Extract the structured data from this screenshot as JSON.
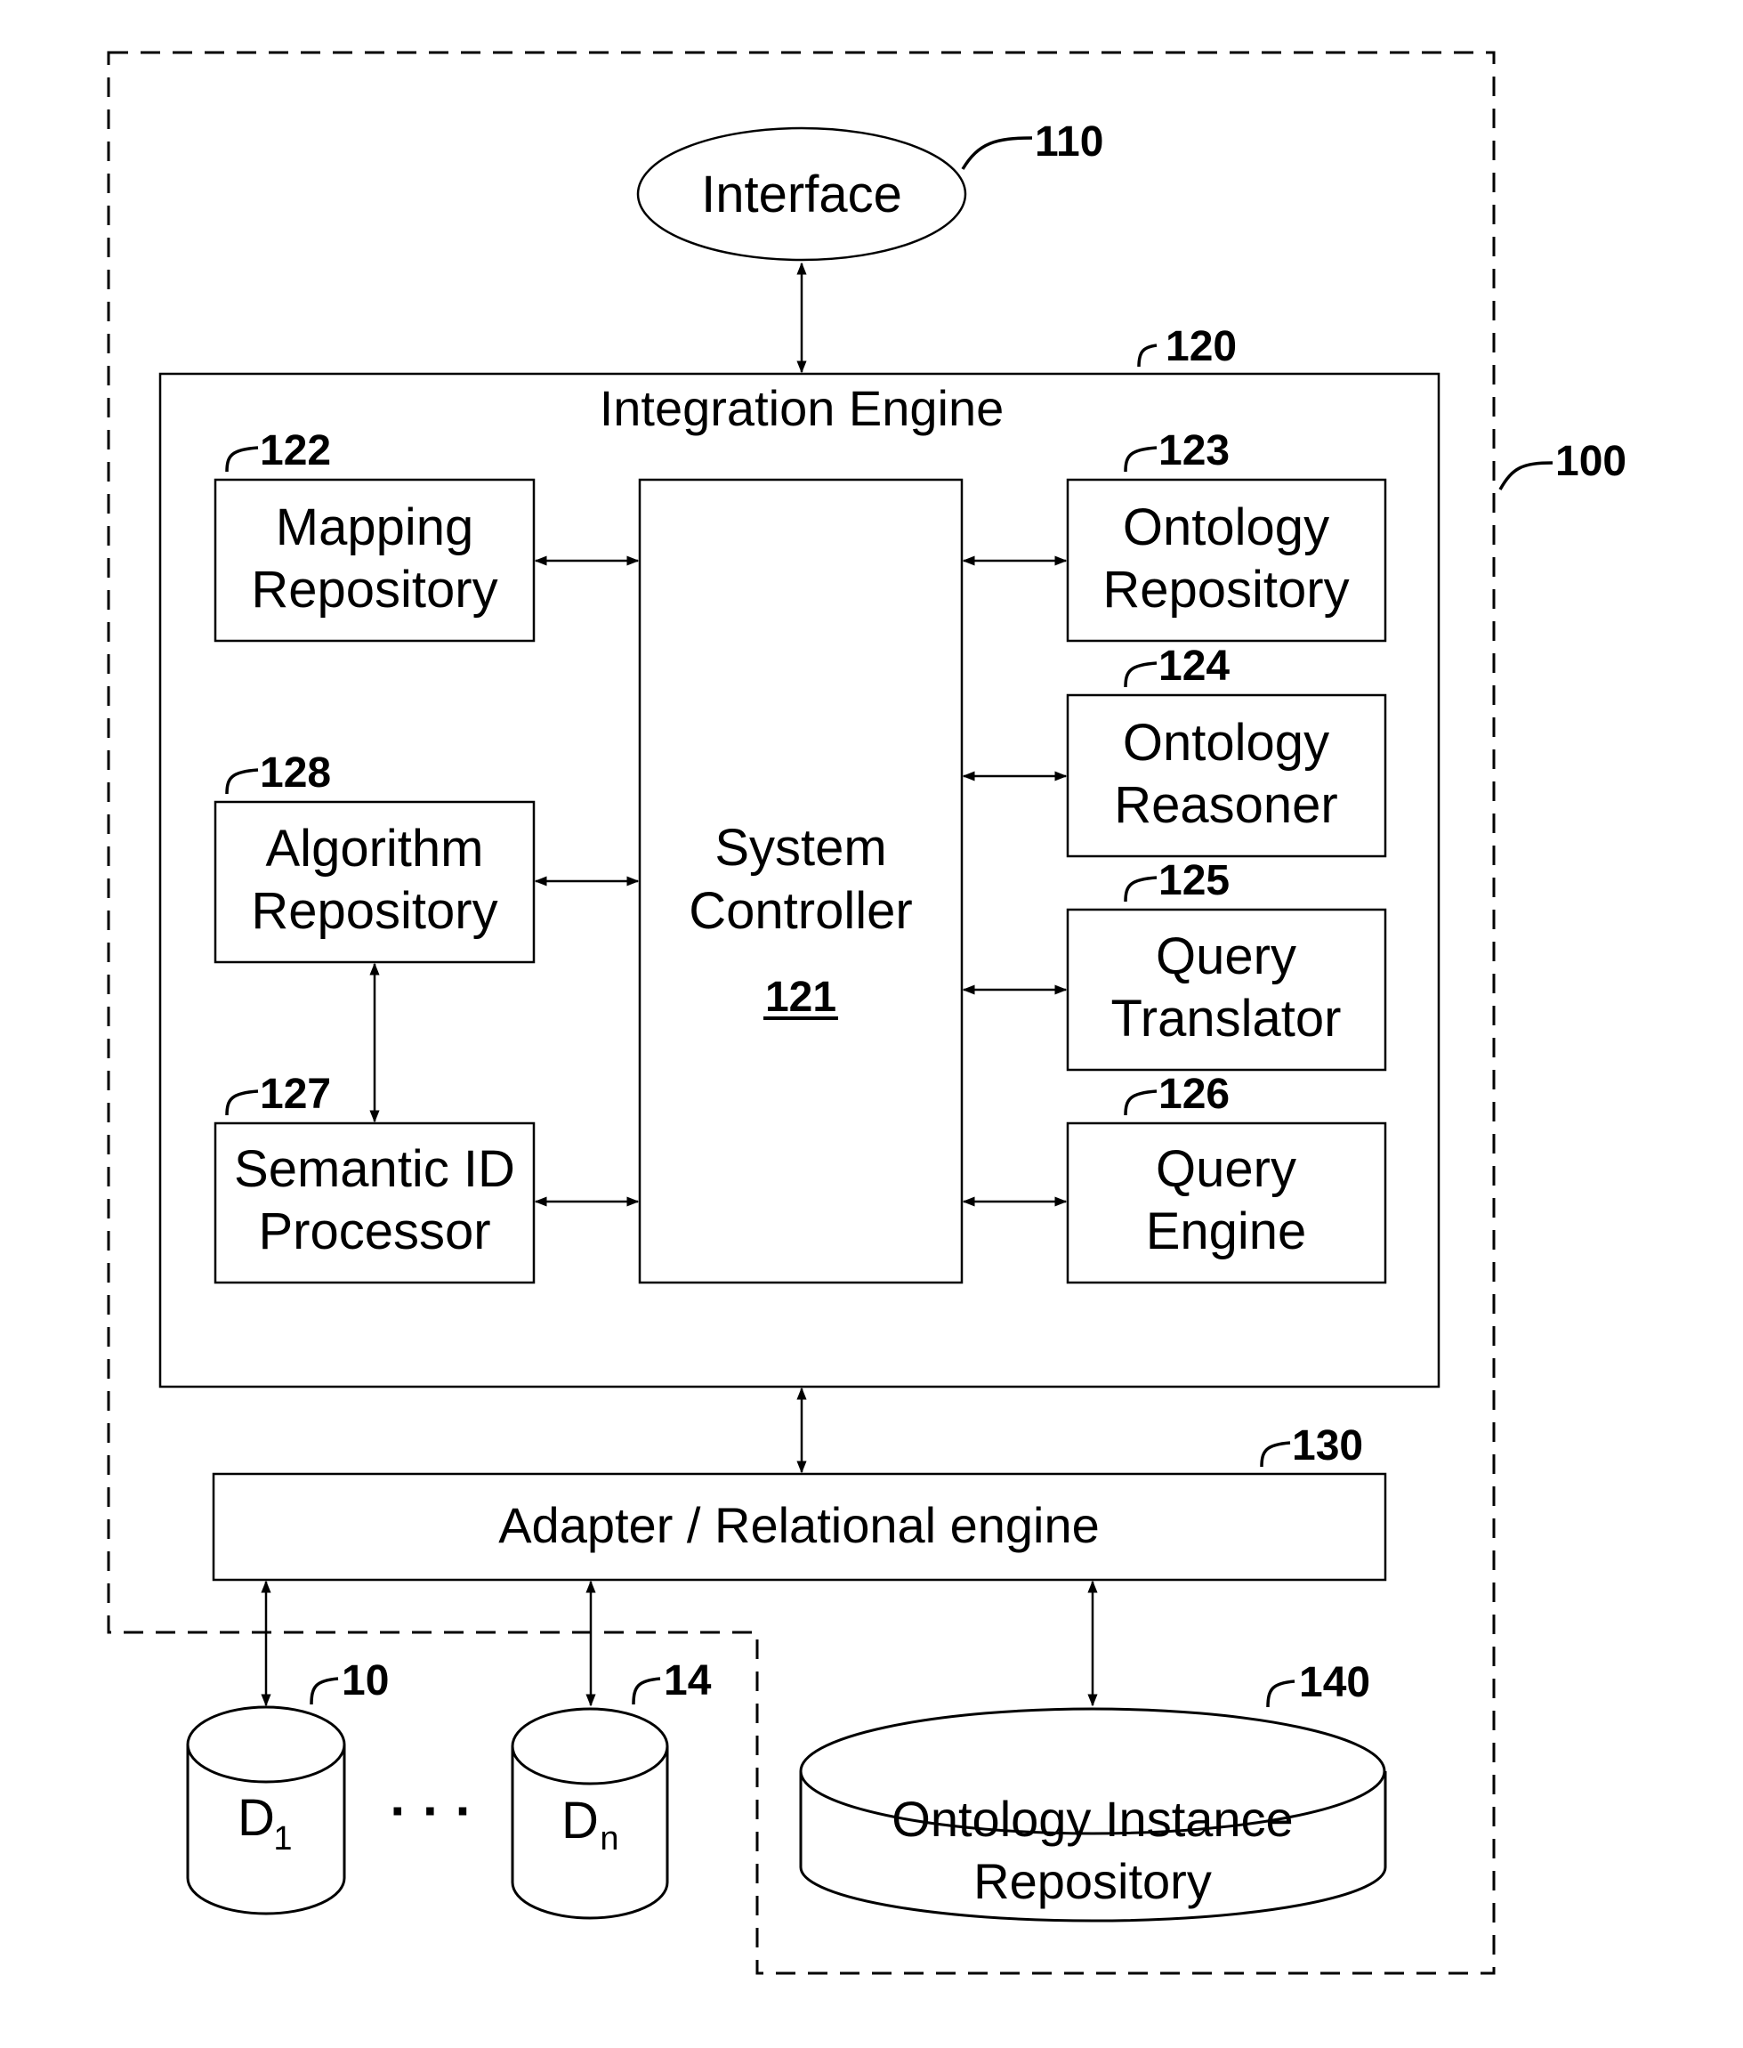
{
  "figure": {
    "system_ref": "100",
    "interface": {
      "label": "Interface",
      "ref": "110"
    },
    "integration_engine": {
      "title": "Integration Engine",
      "ref": "120",
      "system_controller": {
        "line1": "System",
        "line2": "Controller",
        "ref": "121"
      },
      "left_modules": [
        {
          "line1": "Mapping",
          "line2": "Repository",
          "ref": "122"
        },
        {
          "line1": "Algorithm",
          "line2": "Repository",
          "ref": "128"
        },
        {
          "line1": "Semantic ID",
          "line2": "Processor",
          "ref": "127"
        }
      ],
      "right_modules": [
        {
          "line1": "Ontology",
          "line2": "Repository",
          "ref": "123"
        },
        {
          "line1": "Ontology",
          "line2": "Reasoner",
          "ref": "124"
        },
        {
          "line1": "Query",
          "line2": "Translator",
          "ref": "125"
        },
        {
          "line1": "Query",
          "line2": "Engine",
          "ref": "126"
        }
      ]
    },
    "adapter": {
      "label": "Adapter / Relational engine",
      "ref": "130"
    },
    "data_sources": [
      {
        "base": "D",
        "subscript": "1",
        "ref": "10"
      },
      {
        "base": "D",
        "subscript": "n",
        "ref": "14"
      }
    ],
    "ellipsis": "· · ·",
    "ontology_instance_repository": {
      "line1": "Ontology Instance",
      "line2": "Repository",
      "ref": "140"
    }
  }
}
